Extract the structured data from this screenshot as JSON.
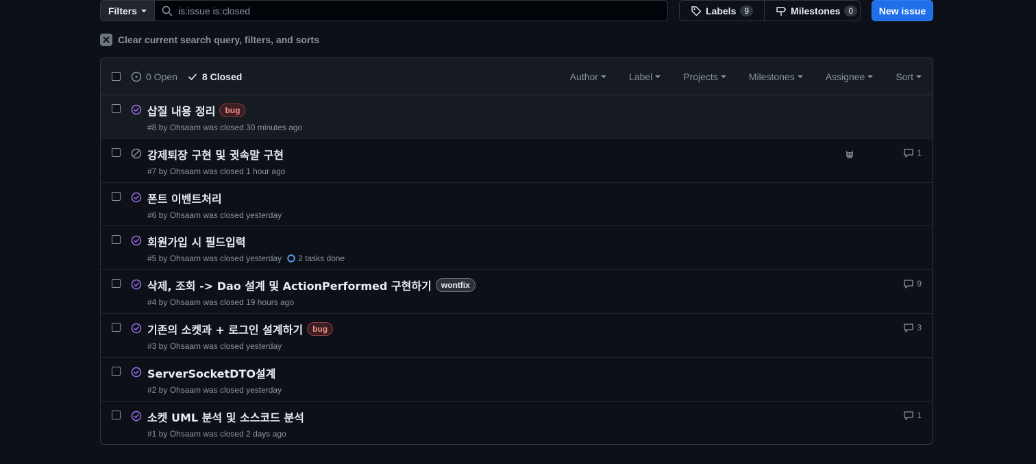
{
  "toolbar": {
    "filters_label": "Filters",
    "search_value": "is:issue is:closed",
    "labels_label": "Labels",
    "labels_count": "9",
    "milestones_label": "Milestones",
    "milestones_count": "0",
    "new_issue_label": "New issue"
  },
  "clear_query": "Clear current search query, filters, and sorts",
  "header": {
    "open_label": "0 Open",
    "closed_label": "8 Closed",
    "sort_items": [
      "Author",
      "Label",
      "Projects",
      "Milestones",
      "Assignee",
      "Sort"
    ]
  },
  "issues": [
    {
      "title": "삽질 내용 정리",
      "label": "bug",
      "meta": "#8 by Ohsaam was closed 30 minutes ago",
      "comments": "",
      "state": "completed"
    },
    {
      "title": "강제퇴장 구현 및 귓속말 구현",
      "label": "",
      "meta": "#7 by Ohsaam was closed 1 hour ago",
      "comments": "1",
      "state": "not-planned"
    },
    {
      "title": "폰트 이벤트처리",
      "label": "",
      "meta": "#6 by Ohsaam was closed yesterday",
      "comments": "",
      "state": "completed"
    },
    {
      "title": "회원가입 시 필드입력",
      "label": "",
      "meta": "#5 by Ohsaam was closed yesterday",
      "tasks": "2 tasks done",
      "comments": "",
      "state": "completed"
    },
    {
      "title": "삭제, 조회 -> Dao 설계 및 ActionPerformed 구현하기",
      "label": "wontfix",
      "meta": "#4 by Ohsaam was closed 19 hours ago",
      "comments": "9",
      "state": "completed"
    },
    {
      "title": "기존의 소켓과 + 로그인 설계하기",
      "label": "bug",
      "meta": "#3 by Ohsaam was closed yesterday",
      "comments": "3",
      "state": "completed"
    },
    {
      "title": "ServerSocketDTO설계",
      "label": "",
      "meta": "#2 by Ohsaam was closed yesterday",
      "comments": "",
      "state": "completed"
    },
    {
      "title": "소켓 UML 분석 및 소스코드 분석",
      "label": "",
      "meta": "#1 by Ohsaam was closed 2 days ago",
      "comments": "1",
      "state": "completed"
    }
  ],
  "colors": {
    "completed": "#a371f7",
    "not_planned": "#8b949e",
    "primary": "#1f6feb"
  }
}
